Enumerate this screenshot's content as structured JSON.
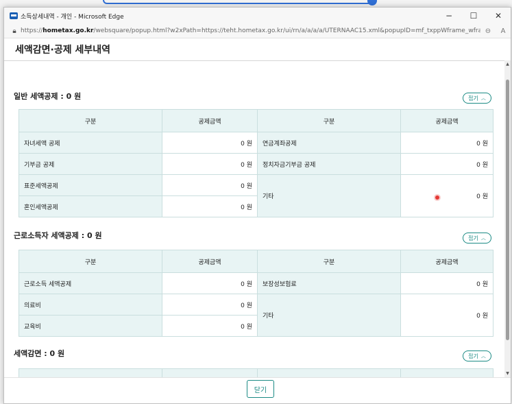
{
  "window": {
    "title": "소득상세내역 - 개인 - Microsoft Edge",
    "minimize": "−",
    "maximize": "☐",
    "close": "✕",
    "url_prefix": "https://",
    "url_host": "hometax.go.kr",
    "url_rest": "/websquare/popup.html?w2xPath=https://teht.hometax.go.kr/ui/rn/a/a/a/a/UTERNAAC15.xml&popupID=mf_txppWframe_wframe2..."
  },
  "page": {
    "title": "세액감면·공제 세부내역",
    "close_button": "닫기"
  },
  "fold_label": "접기",
  "col_headers": [
    "구분",
    "공제금액",
    "구분",
    "공제금액"
  ],
  "sections": [
    {
      "title": "일반 세액공제 : 0 원",
      "rows": [
        {
          "left_label": "자녀세액 공제",
          "left_amount": "0 원",
          "right_label": "연금계좌공제",
          "right_amount": "0 원"
        },
        {
          "left_label": "기부금 공제",
          "left_amount": "0 원",
          "right_label": "정치자금기부금 공제",
          "right_amount": "0 원"
        },
        {
          "left_label": "표준세액공제",
          "left_amount": "0 원",
          "right_label": "기타",
          "right_amount": "0 원"
        },
        {
          "left_label": "혼인세액공제",
          "left_amount": "0 원"
        }
      ]
    },
    {
      "title": "근로소득자 세액공제 : 0 원",
      "rows": [
        {
          "left_label": "근로소득 세액공제",
          "left_amount": "0 원",
          "right_label": "보장성보험료",
          "right_amount": "0 원"
        },
        {
          "left_label": "의료비",
          "left_amount": "0 원",
          "right_label": "기타",
          "right_amount": "0 원"
        },
        {
          "left_label": "교육비",
          "left_amount": "0 원"
        }
      ]
    },
    {
      "title": "세액감면 : 0 원"
    }
  ]
}
